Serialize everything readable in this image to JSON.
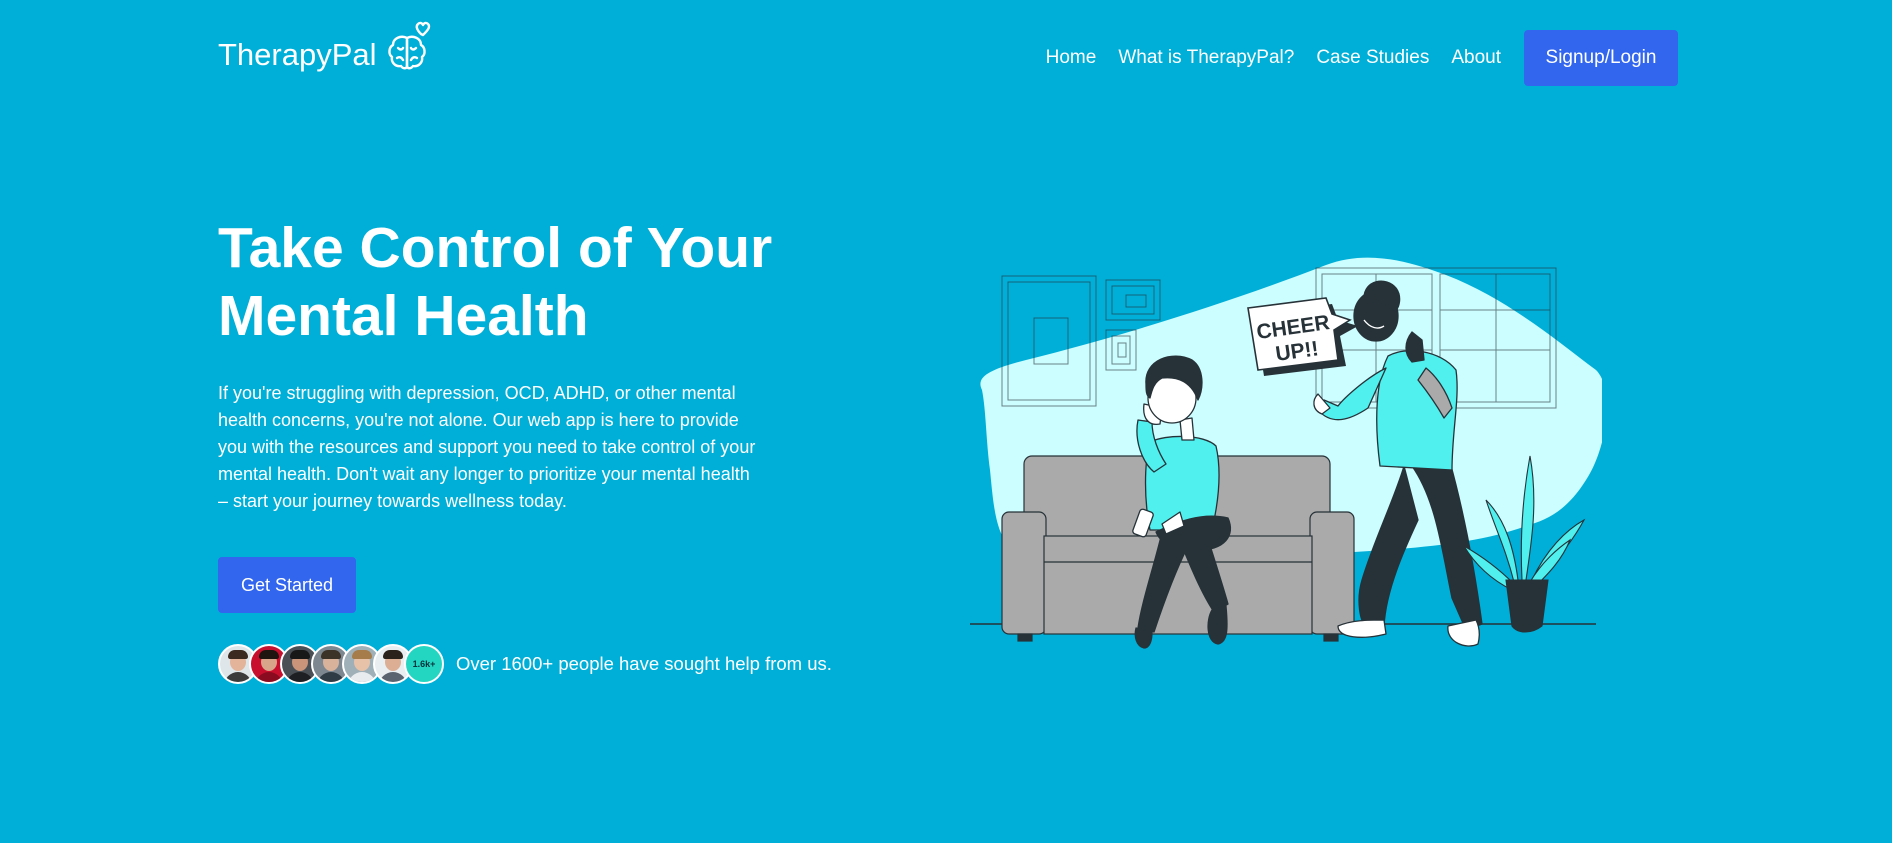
{
  "brand": {
    "name": "TherapyPal",
    "logo_icon": "brain-heart-icon"
  },
  "nav": {
    "items": [
      {
        "label": "Home"
      },
      {
        "label": "What is TherapyPal?"
      },
      {
        "label": "Case Studies"
      },
      {
        "label": "About"
      }
    ],
    "signup_label": "Signup/Login"
  },
  "hero": {
    "title_line1": "Take Control of Your",
    "title_line2": "Mental Health",
    "description": "If you're struggling with depression, OCD, ADHD, or other mental health concerns, you're not alone. Our web app is here to provide you with the resources and support you need to take control of your mental health. Don't wait any longer to prioritize your mental health – start your journey towards wellness today.",
    "cta_label": "Get Started"
  },
  "social_proof": {
    "count_badge": "1.6k+",
    "text": "Over 1600+ people have sought help from us."
  },
  "illustration": {
    "speech_line1": "CHEER",
    "speech_line2": "UP!!"
  },
  "colors": {
    "background": "#00afd8",
    "button": "#3266ee",
    "accent_cyan": "#4ff0ee",
    "blob": "#ccfdff",
    "sofa": "#aaaaaa",
    "dark": "#263238"
  }
}
